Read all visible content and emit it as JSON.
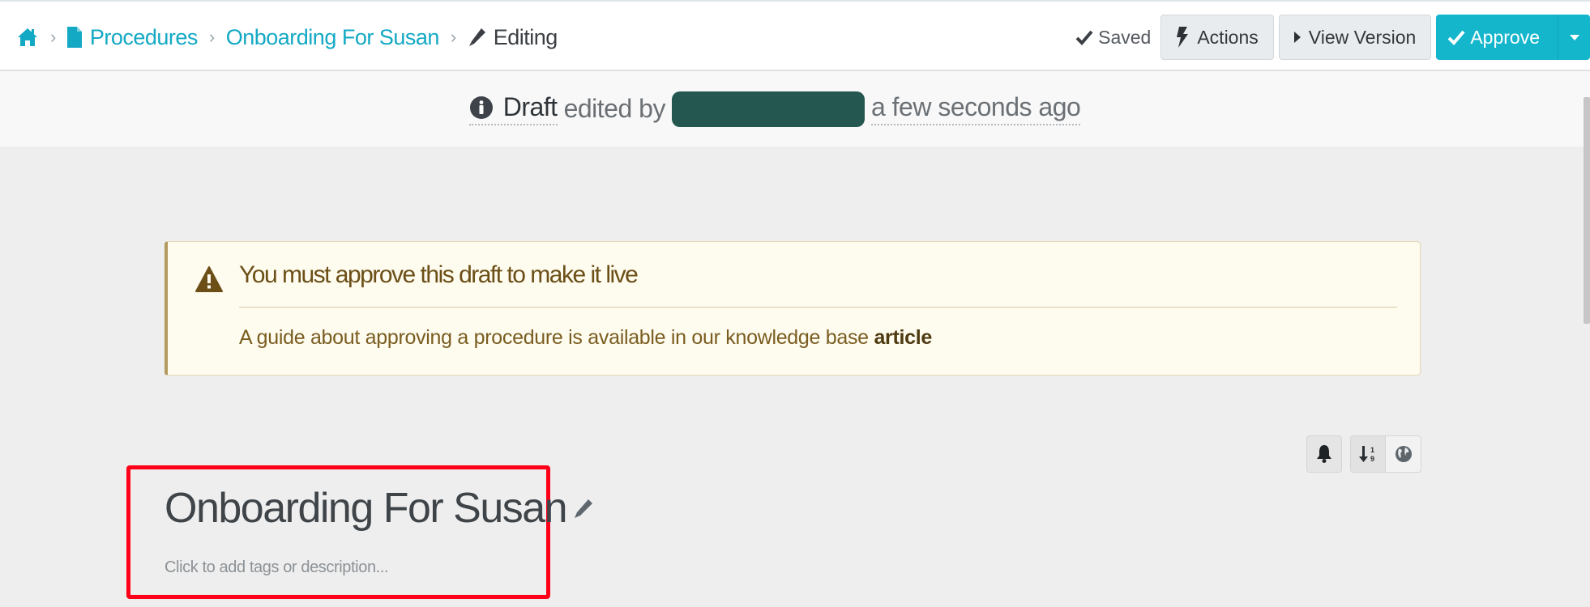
{
  "breadcrumb": {
    "home_icon": "home-icon",
    "items": [
      {
        "label": "Procedures",
        "icon": "file-icon"
      },
      {
        "label": "Onboarding For Susan"
      }
    ],
    "current": {
      "label": "Editing",
      "icon": "pencil-icon"
    },
    "separator": "›"
  },
  "toolbar": {
    "saved_label": "Saved",
    "actions_label": "Actions",
    "view_version_label": "View Version",
    "approve_label": "Approve"
  },
  "draft_status": {
    "status": "Draft",
    "edited_by_text": "edited by",
    "editor": "[redacted]",
    "time": "a few seconds ago"
  },
  "notice": {
    "title": "You must approve this draft to make it live",
    "body": "A guide about approving a procedure is available in our knowledge base ",
    "link_label": "article",
    "colors": {
      "background": "#fefbef",
      "text": "#7a5d20"
    }
  },
  "tools": {
    "notify": "bell-icon",
    "sort": "sort-numeric-icon",
    "language": "globe-icon"
  },
  "procedure": {
    "title": "Onboarding For Susan",
    "description_placeholder": "Click to add tags or description..."
  },
  "colors": {
    "accent": "#14b6cc",
    "highlight_box": "#ff0019"
  }
}
